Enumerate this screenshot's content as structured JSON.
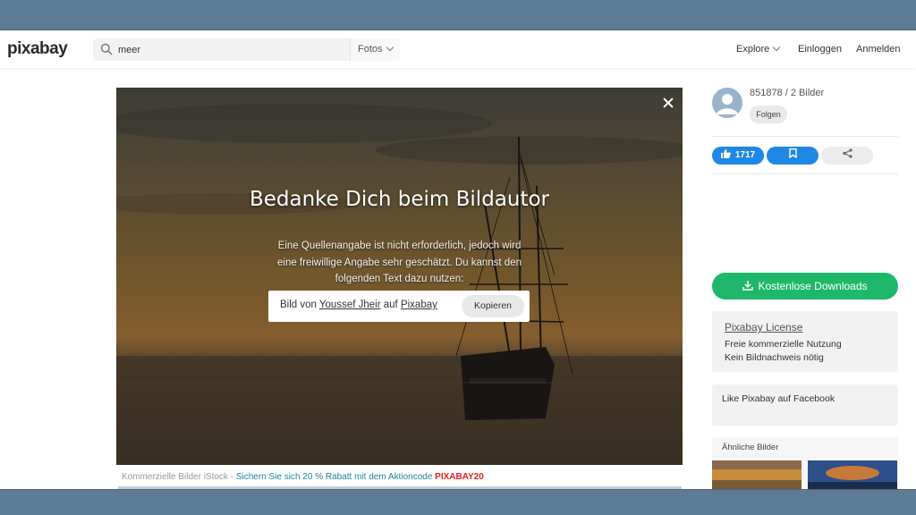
{
  "header": {
    "logo": "pixabay",
    "search": {
      "value": "meer",
      "type_label": "Fotos"
    },
    "nav": {
      "explore": "Explore",
      "login": "Einloggen",
      "signup": "Anmelden"
    }
  },
  "modal": {
    "title": "Bedanke Dich beim Bildautor",
    "text": "Eine Quellenangabe ist nicht erforderlich, jedoch wird eine freiwillige Angabe sehr geschätzt. Du kannst den folgenden Text dazu nutzen:",
    "attribution": {
      "prefix": "Bild von",
      "author": "Youssef Jheir",
      "middle": "auf",
      "site": "Pixabay"
    },
    "copy_label": "Kopieren"
  },
  "promo": {
    "prefix": "Kommerzielle Bilder iStock -",
    "offer": "Sichern Sie sich 20 % Rabatt mit dem Aktioncode",
    "code": "PIXABAY20"
  },
  "sidebar": {
    "user": "851878 / 2 Bilder",
    "follow_label": "Folgen",
    "likes": "1717",
    "download_label": "Kostenlose Downloads",
    "license": {
      "title": "Pixabay License",
      "line1": "Freie kommerzielle Nutzung",
      "line2": "Kein Bildnachweis nötig"
    },
    "facebook": "Like Pixabay auf Facebook",
    "similar_title": "Ähnliche Bilder"
  },
  "colors": {
    "accent_blue": "#1e88e5",
    "download_green": "#1fb86a",
    "frame": "#5e7b96",
    "promo_teal": "#1b8a9b",
    "promo_code": "#e02020"
  },
  "icons": {
    "search": "search-icon",
    "dropdown": "chevron-down-icon",
    "close": "close-icon",
    "like": "thumbs-up-icon",
    "bookmark": "bookmark-icon",
    "share": "share-icon",
    "download": "download-icon",
    "avatar": "user-avatar-icon"
  }
}
